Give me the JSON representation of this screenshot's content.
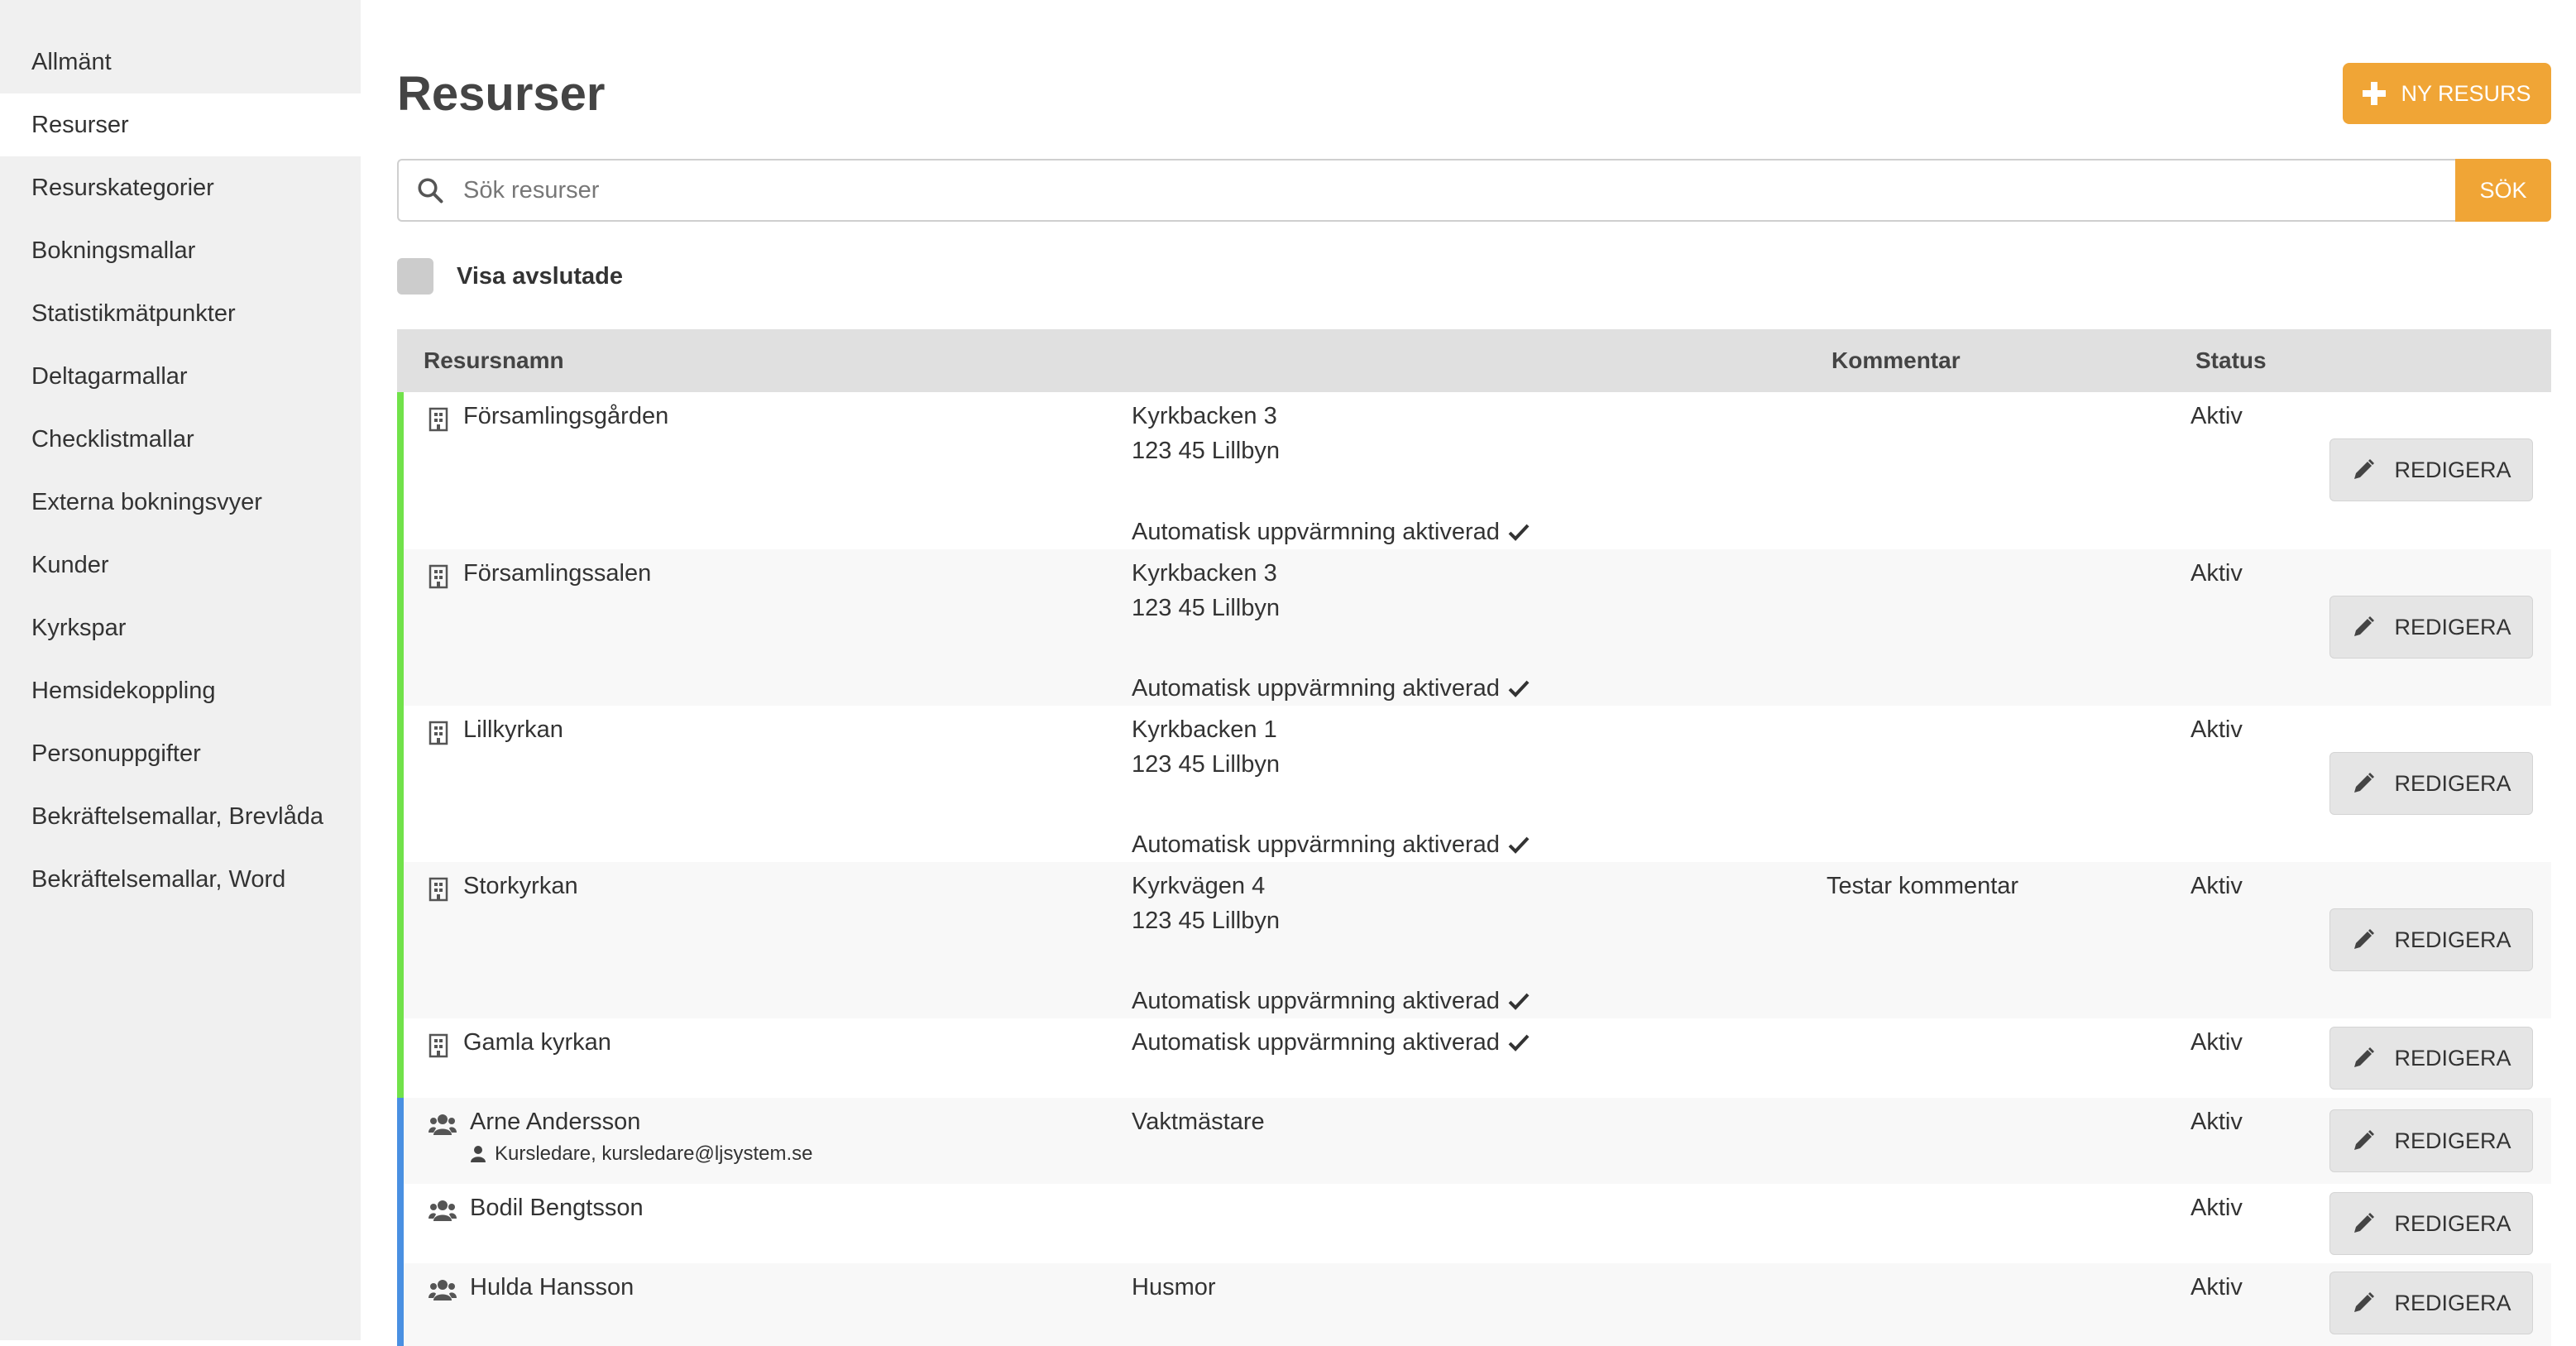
{
  "sidebar": {
    "items": [
      {
        "label": "Allmänt"
      },
      {
        "label": "Resurser",
        "active": true
      },
      {
        "label": "Resurskategorier"
      },
      {
        "label": "Bokningsmallar"
      },
      {
        "label": "Statistikmätpunkter"
      },
      {
        "label": "Deltagarmallar"
      },
      {
        "label": "Checklistmallar"
      },
      {
        "label": "Externa bokningsvyer"
      },
      {
        "label": "Kunder"
      },
      {
        "label": "Kyrkspar"
      },
      {
        "label": "Hemsidekoppling"
      },
      {
        "label": "Personuppgifter"
      },
      {
        "label": "Bekräftelsemallar, Brevlåda"
      },
      {
        "label": "Bekräftelsemallar, Word"
      }
    ]
  },
  "header": {
    "title": "Resurser",
    "new_button": "NY RESURS"
  },
  "search": {
    "placeholder": "Sök resurser",
    "button": "SÖK"
  },
  "filter": {
    "show_ended_label": "Visa avslutade",
    "checked": false
  },
  "table": {
    "columns": {
      "name": "Resursnamn",
      "comment": "Kommentar",
      "status": "Status"
    },
    "edit_label": "REDIGERA",
    "rows": [
      {
        "type": "building",
        "name": "Församlingsgården",
        "address1": "Kyrkbacken 3",
        "address2": "123 45 Lillbyn",
        "heating": "Automatisk uppvärmning aktiverad",
        "comment": "",
        "status": "Aktiv"
      },
      {
        "type": "building",
        "name": "Församlingssalen",
        "address1": "Kyrkbacken 3",
        "address2": "123 45 Lillbyn",
        "heating": "Automatisk uppvärmning aktiverad",
        "comment": "",
        "status": "Aktiv"
      },
      {
        "type": "building",
        "name": "Lillkyrkan",
        "address1": "Kyrkbacken 1",
        "address2": "123 45 Lillbyn",
        "heating": "Automatisk uppvärmning aktiverad",
        "comment": "",
        "status": "Aktiv"
      },
      {
        "type": "building",
        "name": "Storkyrkan",
        "address1": "Kyrkvägen 4",
        "address2": "123 45 Lillbyn",
        "heating": "Automatisk uppvärmning aktiverad",
        "comment": "Testar kommentar",
        "status": "Aktiv"
      },
      {
        "type": "building",
        "name": "Gamla kyrkan",
        "address1": "",
        "address2": "",
        "heating": "Automatisk uppvärmning aktiverad",
        "comment": "",
        "status": "Aktiv"
      },
      {
        "type": "person",
        "name": "Arne Andersson",
        "role": "Kursledare, kursledare@ljsystem.se",
        "title": "Vaktmästare",
        "comment": "",
        "status": "Aktiv"
      },
      {
        "type": "person",
        "name": "Bodil Bengtsson",
        "title": "",
        "comment": "",
        "status": "Aktiv"
      },
      {
        "type": "person",
        "name": "Hulda Hansson",
        "title": "Husmor",
        "comment": "",
        "status": "Aktiv"
      }
    ]
  },
  "colors": {
    "accent": "#f0a536",
    "building_marker": "#71e24a",
    "person_marker": "#4a90e2",
    "header_bg": "#e0e0e0",
    "sidebar_bg": "#f0f0f0"
  },
  "icons": {
    "building": "building-icon",
    "person": "users-icon",
    "edit": "pencil-icon",
    "search": "search-icon",
    "check": "check-icon",
    "user": "user-icon",
    "add": "plus-icon"
  }
}
